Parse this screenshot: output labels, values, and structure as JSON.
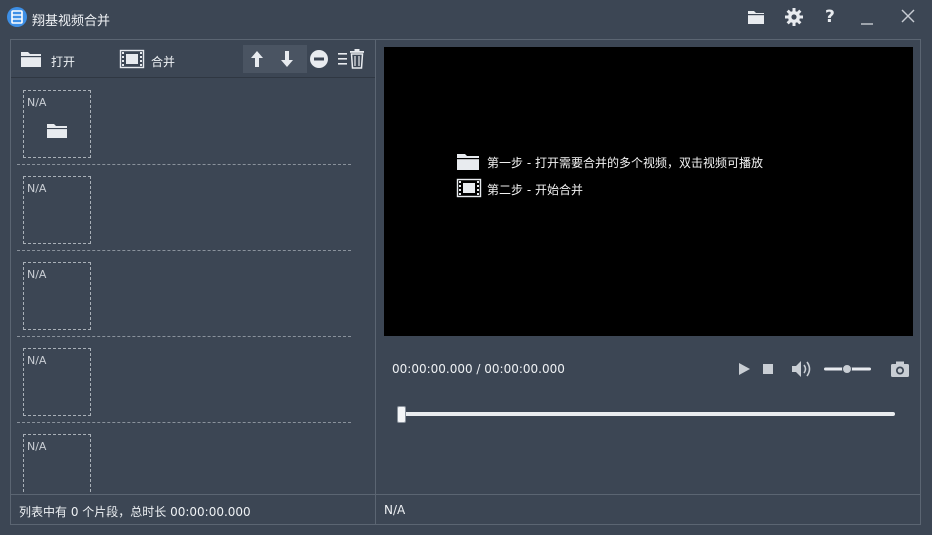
{
  "app": {
    "title": "翔基视频合并",
    "logo_icon": "film-logo-icon",
    "accent": "#3d8fe6"
  },
  "titlebar": {
    "buttons": [
      {
        "name": "open-folder-icon"
      },
      {
        "name": "settings-gear-icon"
      },
      {
        "name": "help-icon",
        "label": "?"
      },
      {
        "name": "minimize-icon"
      },
      {
        "name": "close-icon"
      }
    ]
  },
  "toolbar": {
    "open_label": "打开",
    "merge_label": "合并",
    "actions": [
      "move-up-arrow-icon",
      "move-down-arrow-icon",
      "remove-minus-icon",
      "clear-list-icon"
    ]
  },
  "clips": [
    {
      "label": "N/A",
      "has_folder_icon": true
    },
    {
      "label": "N/A"
    },
    {
      "label": "N/A"
    },
    {
      "label": "N/A"
    },
    {
      "label": "N/A"
    }
  ],
  "player": {
    "step1": "第一步 - 打开需要合并的多个视频，双击视频可播放",
    "step2": "第二步 - 开始合并",
    "time": "00:00:00.000 / 00:00:00.000",
    "progress": 0,
    "volume_level": 0.45
  },
  "status": {
    "left": "列表中有 0 个片段，总时长 00:00:00.000",
    "right": "N/A"
  }
}
